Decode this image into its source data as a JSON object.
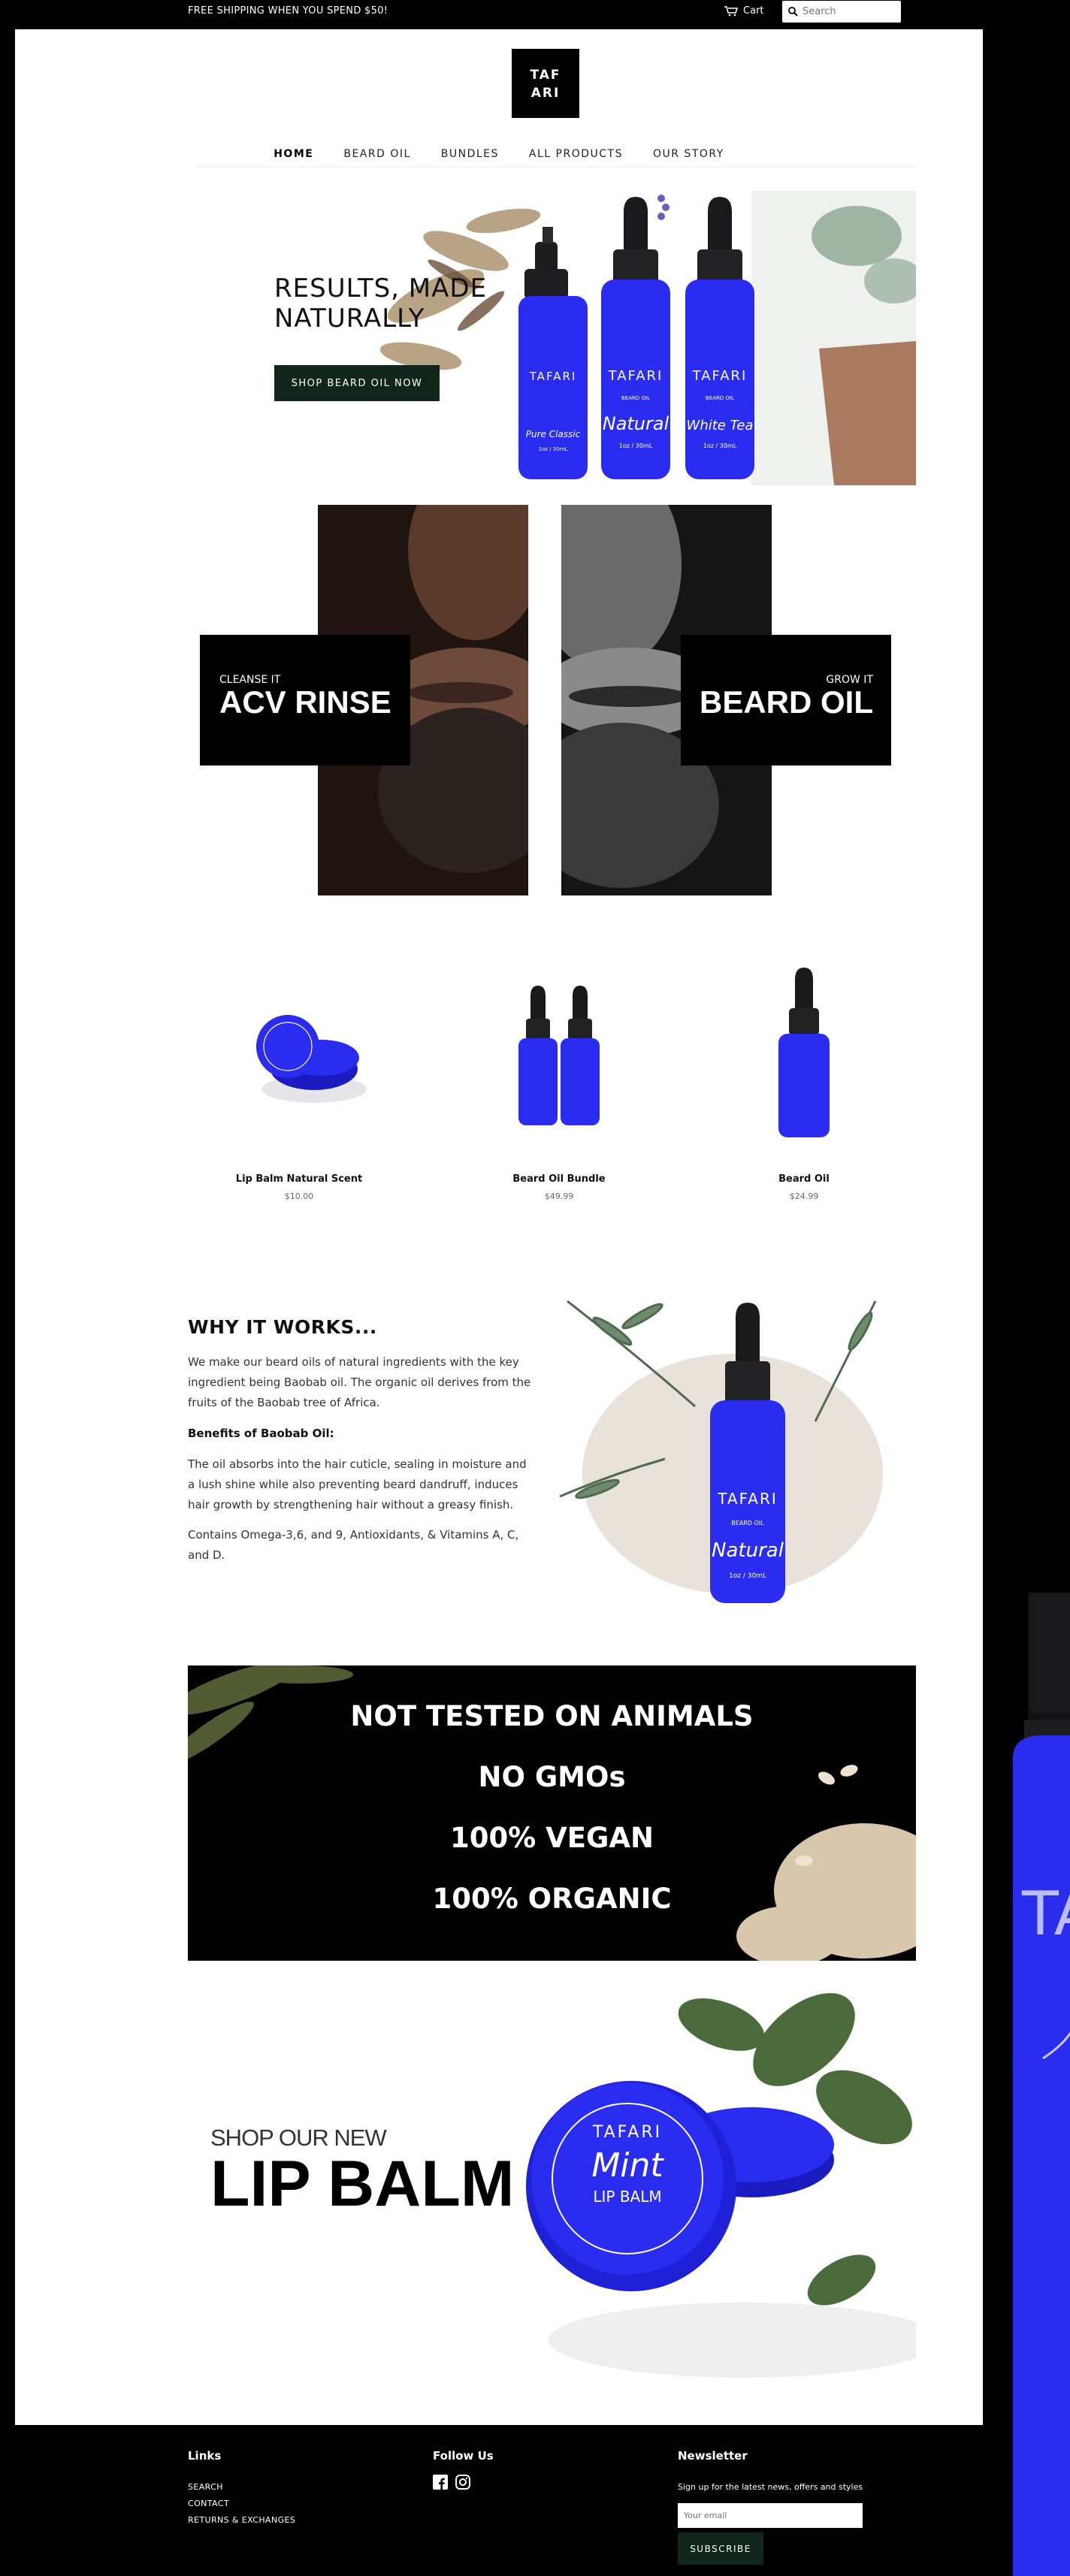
{
  "topbar": {
    "announcement": "FREE SHIPPING WHEN YOU SPEND $50!",
    "cart_label": "Cart",
    "search_placeholder": "Search"
  },
  "logo": {
    "line1": "TAF",
    "line2": "ARI"
  },
  "nav": {
    "items": [
      {
        "label": "HOME",
        "active": true
      },
      {
        "label": "BEARD OIL"
      },
      {
        "label": "BUNDLES"
      },
      {
        "label": "ALL PRODUCTS"
      },
      {
        "label": "OUR STORY"
      }
    ]
  },
  "hero": {
    "headline_line1": "RESULTS, MADE",
    "headline_line2": "NATURALLY",
    "cta": "SHOP BEARD OIL NOW",
    "bottle_labels": [
      {
        "brand": "TAFARI",
        "type": "",
        "script": "Pure Classic",
        "volume": "1oz / 30mL"
      },
      {
        "brand": "TAFARI",
        "type": "BEARD OIL",
        "script": "Natural",
        "volume": "1oz / 30mL"
      },
      {
        "brand": "TAFARI",
        "type": "BEARD OIL",
        "script": "White Tea",
        "volume": "1oz / 30mL"
      }
    ]
  },
  "features": [
    {
      "small": "CLEANSE IT",
      "big": "ACV RINSE"
    },
    {
      "small": "GROW IT",
      "big": "BEARD OIL"
    }
  ],
  "products": [
    {
      "title": "Lip Balm Natural Scent",
      "price": "$10.00"
    },
    {
      "title": "Beard Oil Bundle",
      "price": "$49.99"
    },
    {
      "title": "Beard Oil",
      "price": "$24.99"
    }
  ],
  "why": {
    "heading": "WHY IT WORKS...",
    "para1": "We make our beard oils of natural ingredients with the key ingredient being Baobab oil. The organic oil derives from the fruits of the Baobab tree of Africa.",
    "benefits_heading": "Benefits of Baobab Oil:",
    "para2": "The oil absorbs into the hair cuticle, sealing in moisture and a lush shine while also preventing beard dandruff, induces hair growth by strengthening hair without a greasy finish.",
    "para3": "Contains Omega-3,6, and 9, Antioxidants, & Vitamins A, C, and D.",
    "bottle": {
      "brand": "TAFARI",
      "type": "BEARD OIL",
      "script": "Natural",
      "volume": "1oz / 30mL"
    }
  },
  "banner": {
    "line1": "NOT TESTED ON ANIMALS",
    "line2": "NO GMOs",
    "line3": "100% VEGAN",
    "line4": "100% ORGANIC"
  },
  "lipbalm": {
    "small": "SHOP OUR NEW",
    "big": "LIP BALM",
    "tin_brand": "TAFARI",
    "tin_script": "Mint",
    "tin_type": "LIP BALM"
  },
  "footer": {
    "links_heading": "Links",
    "links": [
      "SEARCH",
      "CONTACT",
      "RETURNS & EXCHANGES"
    ],
    "follow_heading": "Follow Us",
    "newsletter_heading": "Newsletter",
    "newsletter_text": "Sign up for the latest news, offers and styles",
    "email_placeholder": "Your email",
    "subscribe": "SUBSCRIBE"
  },
  "side_bottle": {
    "brand": "TA"
  },
  "colors": {
    "bottle_blue": "#2a2cf0",
    "dark_green_button": "#10261b",
    "page_black": "#000000"
  }
}
